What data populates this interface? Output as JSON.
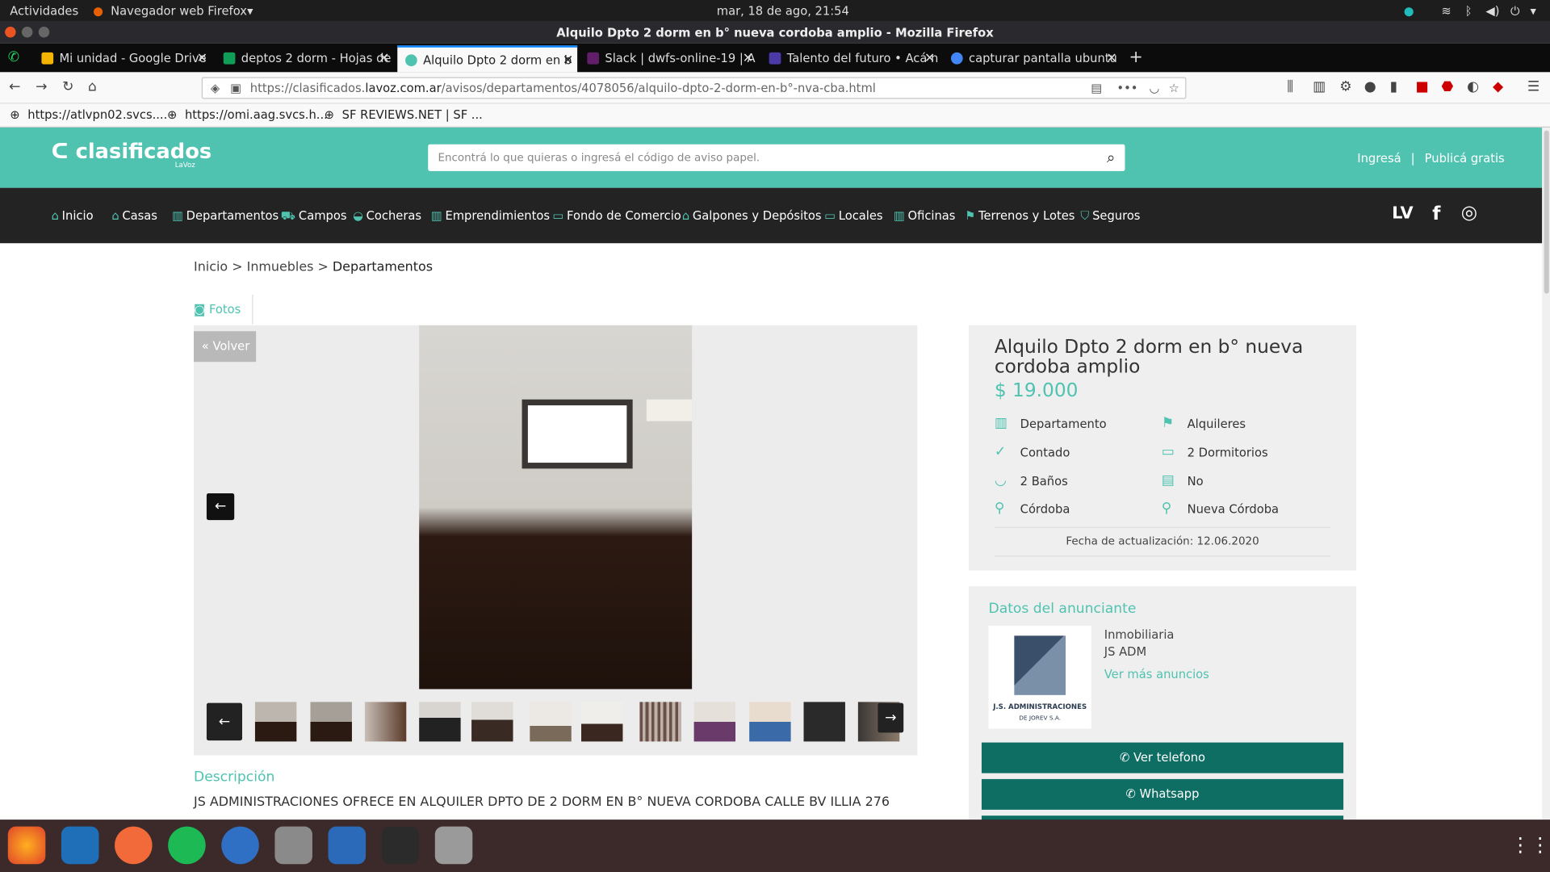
{
  "gnome": {
    "activities": "Actividades",
    "app": "Navegador web Firefox",
    "clock": "mar, 18 de ago, 21:54"
  },
  "window": {
    "title": "Alquilo Dpto 2 dorm en b° nueva cordoba amplio - Mozilla Firefox"
  },
  "tabs": [
    {
      "label": "Mi unidad - Google Drive",
      "color": "#f4b400"
    },
    {
      "label": "deptos 2 dorm - Hojas de",
      "color": "#0f9d58"
    },
    {
      "label": "Alquilo Dpto 2 dorm en b",
      "color": "#4fc3b0"
    },
    {
      "label": "Slack | dwfs-online-19 | A",
      "color": "#611f69"
    },
    {
      "label": "Talento del futuro • Acá n",
      "color": "#4a3aa8"
    },
    {
      "label": "capturar pantalla ubuntu",
      "color": "#4285f4"
    }
  ],
  "url": {
    "prefix": "https://clasificados.",
    "domain": "lavoz.com.ar",
    "path": "/avisos/departamentos/4078056/alquilo-dpto-2-dorm-en-b°-nva-cba.html"
  },
  "bookmarks": [
    "https://atlvpn02.svcs....",
    "https://omi.aag.svcs.h...",
    "SF REVIEWS.NET | SF ..."
  ],
  "site": {
    "logo": "clasificados",
    "logo_sub": "LaVoz",
    "search_placeholder": "Encontrá lo que quieras o ingresá el código de aviso papel.",
    "login": "Ingresá",
    "separator": "|",
    "publish": "Publicá gratis",
    "social": [
      "LV",
      "f",
      "◎"
    ]
  },
  "categories": [
    "Inicio",
    "Casas",
    "Departamentos",
    "Campos",
    "Cocheras",
    "Emprendimientos",
    "Fondo de Comercio",
    "Galpones y Depósitos",
    "Locales",
    "Oficinas",
    "Terrenos y Lotes",
    "Seguros"
  ],
  "breadcrumb": {
    "home": "Inicio",
    "sep": ">",
    "section": "Inmuebles",
    "current": "Departamentos"
  },
  "gallery": {
    "tab": "Fotos",
    "back": "Volver"
  },
  "listing": {
    "title": "Alquilo Dpto 2 dorm en b° nueva cordoba amplio",
    "price": "$ 19.000",
    "features": [
      "Departamento",
      "Alquileres",
      "Contado",
      "2 Dormitorios",
      "2 Baños",
      "No",
      "Córdoba",
      "Nueva Córdoba"
    ],
    "updated": "Fecha de actualización: 12.06.2020"
  },
  "advertiser": {
    "section_title": "Datos del anunciante",
    "type": "Inmobiliaria",
    "name": "JS ADM",
    "more": "Ver más anuncios",
    "logo_text1": "J.S. ADMINISTRACIONES",
    "logo_text2": "DE JOREV S.A."
  },
  "buttons": {
    "phone": "Ver telefono",
    "whatsapp": "Whatsapp"
  },
  "description": {
    "title": "Descripción",
    "text": "JS ADMINISTRACIONES OFRECE EN ALQUILER DPTO DE 2 DORM EN B° NUEVA CORDOBA CALLE BV ILLIA 276"
  }
}
